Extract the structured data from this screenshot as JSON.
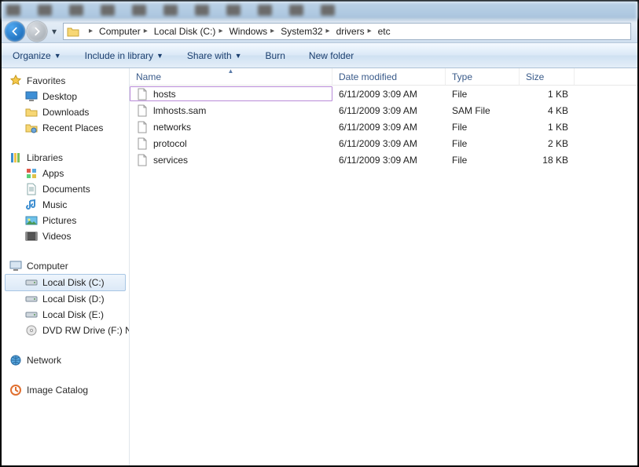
{
  "breadcrumb": [
    {
      "label": "Computer"
    },
    {
      "label": "Local Disk (C:)"
    },
    {
      "label": "Windows"
    },
    {
      "label": "System32"
    },
    {
      "label": "drivers"
    },
    {
      "label": "etc"
    }
  ],
  "toolbar": {
    "organize": "Organize",
    "include": "Include in library",
    "share": "Share with",
    "burn": "Burn",
    "newfolder": "New folder"
  },
  "nav": {
    "favorites": {
      "label": "Favorites",
      "items": [
        {
          "label": "Desktop",
          "icon": "desktop"
        },
        {
          "label": "Downloads",
          "icon": "folder"
        },
        {
          "label": "Recent Places",
          "icon": "recent"
        }
      ]
    },
    "libraries": {
      "label": "Libraries",
      "items": [
        {
          "label": "Apps",
          "icon": "apps"
        },
        {
          "label": "Documents",
          "icon": "documents"
        },
        {
          "label": "Music",
          "icon": "music"
        },
        {
          "label": "Pictures",
          "icon": "pictures"
        },
        {
          "label": "Videos",
          "icon": "videos"
        }
      ]
    },
    "computer": {
      "label": "Computer",
      "items": [
        {
          "label": "Local Disk (C:)",
          "icon": "hdd",
          "selected": true
        },
        {
          "label": "Local Disk (D:)",
          "icon": "hdd"
        },
        {
          "label": "Local Disk (E:)",
          "icon": "hdd"
        },
        {
          "label": "DVD RW Drive (F:)  N",
          "icon": "dvd"
        }
      ]
    },
    "network": {
      "label": "Network"
    },
    "catalog": {
      "label": "Image Catalog"
    }
  },
  "columns": {
    "name": "Name",
    "date": "Date modified",
    "type": "Type",
    "size": "Size"
  },
  "files": [
    {
      "name": "hosts",
      "date": "6/11/2009 3:09 AM",
      "type": "File",
      "size": "1 KB",
      "selected": true
    },
    {
      "name": "lmhosts.sam",
      "date": "6/11/2009 3:09 AM",
      "type": "SAM File",
      "size": "4 KB"
    },
    {
      "name": "networks",
      "date": "6/11/2009 3:09 AM",
      "type": "File",
      "size": "1 KB"
    },
    {
      "name": "protocol",
      "date": "6/11/2009 3:09 AM",
      "type": "File",
      "size": "2 KB"
    },
    {
      "name": "services",
      "date": "6/11/2009 3:09 AM",
      "type": "File",
      "size": "18 KB"
    }
  ]
}
